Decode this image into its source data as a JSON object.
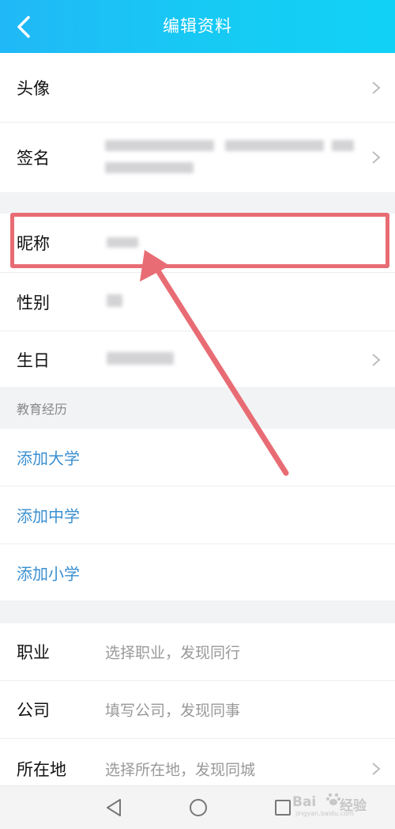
{
  "header": {
    "title": "编辑资料"
  },
  "profile": {
    "avatar_label": "头像",
    "signature_label": "签名"
  },
  "basic": {
    "nickname_label": "昵称",
    "gender_label": "性别",
    "birthday_label": "生日"
  },
  "education": {
    "section_title": "教育经历",
    "add_university": "添加大学",
    "add_middle_school": "添加中学",
    "add_primary_school": "添加小学"
  },
  "work": {
    "occupation_label": "职业",
    "occupation_placeholder": "选择职业，发现同行",
    "company_label": "公司",
    "company_placeholder": "填写公司，发现同事",
    "location_label": "所在地",
    "location_placeholder": "选择所在地，发现同城"
  },
  "watermark": {
    "brand_a": "Bai",
    "brand_b": "经验",
    "domain": "jingyan.baidu.com"
  },
  "colors": {
    "header": "#21b8f7",
    "link": "#3a8fd0",
    "highlight": "#e86c74"
  },
  "icons": [
    "back-arrow-icon",
    "chevron-right-icon",
    "nav-back-icon",
    "nav-home-icon",
    "nav-recent-icon",
    "baidu-paw-icon"
  ]
}
